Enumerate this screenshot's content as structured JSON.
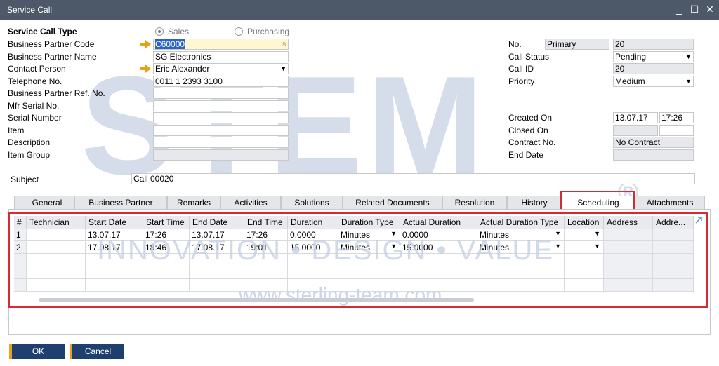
{
  "window": {
    "title": "Service Call",
    "minimize": "_",
    "maximize": "☐",
    "close": "✕"
  },
  "header": {
    "service_call_type_label": "Service Call Type",
    "type_sales": "Sales",
    "type_purchasing": "Purchasing",
    "bp_code_label": "Business Partner Code",
    "bp_code_value": "C60000",
    "bp_name_label": "Business Partner Name",
    "bp_name_value": "SG Electronics",
    "contact_label": "Contact Person",
    "contact_value": "Eric Alexander",
    "phone_label": "Telephone No.",
    "phone_value": "0011 1 2393 3100",
    "bp_ref_label": "Business Partner Ref. No.",
    "mfr_serial_label": "Mfr Serial No.",
    "serial_label": "Serial Number",
    "item_label": "Item",
    "description_label": "Description",
    "item_group_label": "Item Group",
    "subject_label": "Subject",
    "subject_value": "Call 00020"
  },
  "right": {
    "no_label": "No.",
    "no_series": "Primary",
    "no_value": "20",
    "status_label": "Call Status",
    "status_value": "Pending",
    "callid_label": "Call ID",
    "callid_value": "20",
    "priority_label": "Priority",
    "priority_value": "Medium",
    "created_label": "Created On",
    "created_date": "13.07.17",
    "created_time": "17:26",
    "closed_label": "Closed On",
    "contract_label": "Contract No.",
    "contract_value": "No Contract",
    "enddate_label": "End Date"
  },
  "tabs": [
    "General",
    "Business Partner",
    "Remarks",
    "Activities",
    "Solutions",
    "Related Documents",
    "Resolution",
    "History",
    "Scheduling",
    "Attachments"
  ],
  "grid": {
    "columns": [
      "#",
      "Technician",
      "Start Date",
      "Start Time",
      "End Date",
      "End Time",
      "Duration",
      "Duration Type",
      "Actual Duration",
      "Actual Duration Type",
      "Location",
      "Address",
      "Addre..."
    ],
    "rows": [
      [
        "1",
        "",
        "13.07.17",
        "17:26",
        "13.07.17",
        "17:26",
        "0.0000",
        "Minutes",
        "0.0000",
        "Minutes",
        "",
        "",
        ""
      ],
      [
        "2",
        "",
        "17.08.17",
        "18:46",
        "17.08.17",
        "19:01",
        "15.0000",
        "Minutes",
        "15.0000",
        "Minutes",
        "",
        "",
        ""
      ]
    ]
  },
  "buttons": {
    "ok": "OK",
    "cancel": "Cancel"
  },
  "watermark": {
    "main": "STEM",
    "registered": "®",
    "tagline": "INNOVATION • DESIGN • VALUE",
    "url": "www.sterling-team.com"
  },
  "colors": {
    "titlebar": "#4d5868",
    "highlight": "#d62a35",
    "button": "#1f3f6e",
    "button_accent": "#e8a21a",
    "link_arrow": "#e8a21a"
  }
}
